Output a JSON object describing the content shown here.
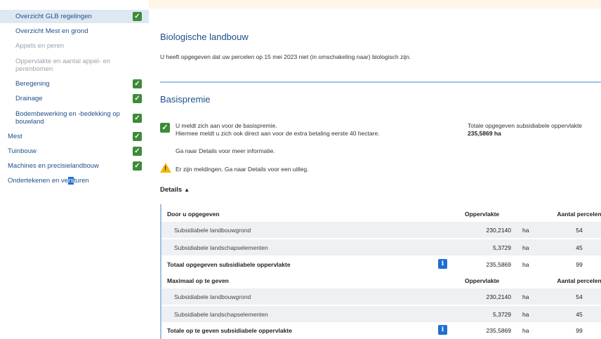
{
  "sidebar": {
    "items": [
      {
        "label": "Overzicht GLB regelingen",
        "checked": true,
        "active": true
      },
      {
        "label": "Overzicht Mest en grond",
        "checked": false
      },
      {
        "label": "Appels en peren",
        "checked": false,
        "disabled": true
      },
      {
        "label": "Oppervlakte en aantal appel- en perenbomen",
        "checked": false,
        "disabled": true
      },
      {
        "label": "Beregening",
        "checked": true
      },
      {
        "label": "Drainage",
        "checked": true
      },
      {
        "label": "Bodembewerking en -bedekking op bouwland",
        "checked": true
      },
      {
        "label": "Mest",
        "checked": true
      },
      {
        "label": "Tuinbouw",
        "checked": true
      },
      {
        "label": "Machines en precisielandbouw",
        "checked": true
      },
      {
        "label_before": "Ondertekenen en ve",
        "label_highlight": "rs",
        "label_after": "turen",
        "checked": false
      }
    ]
  },
  "biologisch": {
    "title": "Biologische landbouw",
    "text": "U heeft opgegeven dat uw percelen op 15 mei 2023 niet (in omschakeling naar) biologisch zijn."
  },
  "basispremie": {
    "title": "Basispremie",
    "line1": "U meldt zich aan voor de basispremie.",
    "line2": "Hiermee meldt u zich ook direct aan voor de extra betaling eerste 40 hectare.",
    "line3": "Ga naar Details voor meer informatie.",
    "warning": "Er zijn meldingen. Ga naar Details voor een uitleg.",
    "total_label": "Totale opgegeven subsidiabele oppervlakte",
    "total_value": "235,5869 ha",
    "details_label": "Details"
  },
  "table": {
    "header1": {
      "label": "Door u opgegeven",
      "col2": "Oppervlakte",
      "col4": "Aantal percelen"
    },
    "rows1": [
      {
        "label": "Subsidiabele landbouwgrond",
        "value": "230,2140",
        "unit": "ha",
        "count": "54"
      },
      {
        "label": "Subsidiabele landschapselementen",
        "value": "5,3729",
        "unit": "ha",
        "count": "45"
      }
    ],
    "total1": {
      "label": "Totaal opgegeven subsidiabele oppervlakte",
      "value": "235,5869",
      "unit": "ha",
      "count": "99"
    },
    "header2": {
      "label": "Maximaal op te geven",
      "col2": "Oppervlakte",
      "col4": "Aantal percelen"
    },
    "rows2": [
      {
        "label": "Subsidiabele landbouwgrond",
        "value": "230,2140",
        "unit": "ha",
        "count": "54"
      },
      {
        "label": "Subsidiabele landschapselementen",
        "value": "5,3729",
        "unit": "ha",
        "count": "45"
      }
    ],
    "total2": {
      "label": "Totale op te geven subsidiabele oppervlakte",
      "value": "235,5869",
      "unit": "ha",
      "count": "99"
    }
  },
  "icons": {
    "check": "check-icon",
    "warning": "warning-icon",
    "info": "info-icon",
    "chevron": "chevron-up-icon"
  },
  "colors": {
    "link": "#1f4e8c",
    "check": "#3d8b37",
    "info": "#1f6fd1",
    "warning": "#f2b705",
    "divider": "#9fc2e3"
  }
}
